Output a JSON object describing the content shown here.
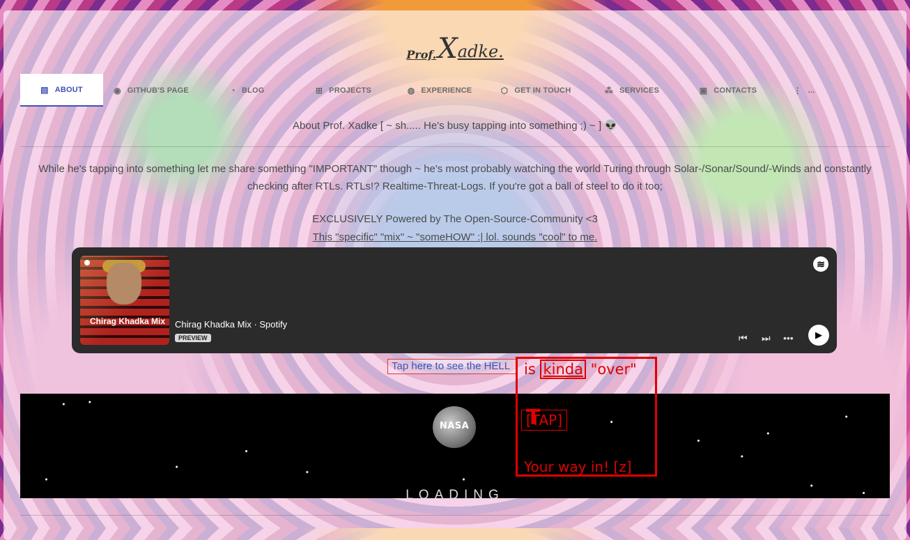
{
  "logo": {
    "prof": "Prof.",
    "initial": "X",
    "rest": "adke."
  },
  "tabs": [
    {
      "label": "ABOUT",
      "icon": "id-card-icon"
    },
    {
      "label": "GITHUB'S PAGE",
      "icon": "github-icon"
    },
    {
      "label": "BLOG",
      "icon": "rss-icon"
    },
    {
      "label": "PROJECTS",
      "icon": "sitemap-icon"
    },
    {
      "label": "EXPERIENCE",
      "icon": "dribbble-icon"
    },
    {
      "label": "GET IN TOUCH",
      "icon": "handshake-icon"
    },
    {
      "label": "SERVICES",
      "icon": "network-icon"
    },
    {
      "label": "CONTACTS",
      "icon": "contact-book-icon"
    },
    {
      "label": "...",
      "icon": "more-vertical-icon"
    }
  ],
  "active_tab": "ABOUT",
  "about_line": "About Prof. Xadke [ ~ sh..... He's busy tapping into something ;) ~ ] 👽",
  "description": "While he's tapping into something let me share something \"IMPORTANT\" though ~ he's most probably watching the world Turing through Solar-/Sonar/Sound/-Winds and constantly checking after RTLs. RTLs!? Realtime-Threat-Logs. If you're got a ball of steel to do it too;",
  "powered_by": "EXCLUSIVELY Powered by The Open-Source-Community <3",
  "mix_link": "This \"specific\" \"mix\" ~ \"someHOW\" :| lol. sounds \"cool\" to me.",
  "spotify": {
    "cover_title": "Chirag Khadka Mix",
    "title": "Chirag Khadka Mix · Spotify",
    "badge": "PREVIEW"
  },
  "hell_link": "Tap here to see the HELL",
  "overlay": {
    "word_is": "is",
    "word_kinda": "kinda",
    "word_over": "\"over\"",
    "tap": "[TAP]",
    "way": "Your way in! [z]"
  },
  "nasa_label": "NASA",
  "loading": "LOADING",
  "colors": {
    "accent": "#3f51b5",
    "alert": "#e00000",
    "spotify_bg": "#2b2b2b"
  }
}
